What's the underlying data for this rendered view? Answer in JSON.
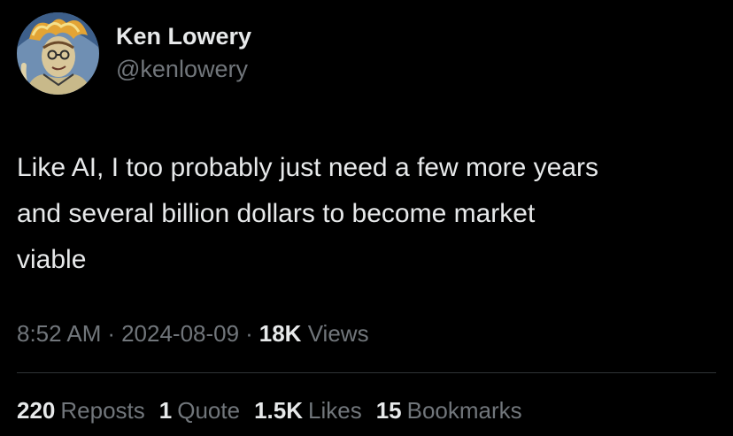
{
  "colors": {
    "background": "#000000",
    "primary_text": "#e7e9ea",
    "secondary_text": "#71767b",
    "divider": "#2f3336"
  },
  "author": {
    "avatar_icon": "illustrated-portrait-avatar",
    "display_name": "Ken Lowery",
    "handle": "@kenlowery"
  },
  "tweet": {
    "text": "Like AI, I too probably just need a few more years\nand several billion dollars to become market\nviable",
    "time": "8:52 AM",
    "separator": "·",
    "date": "2024-08-09",
    "views_count": "18K",
    "views_label": "Views"
  },
  "stats": [
    {
      "count": "220",
      "label": "Reposts"
    },
    {
      "count": "1",
      "label": "Quote"
    },
    {
      "count": "1.5K",
      "label": "Likes"
    },
    {
      "count": "15",
      "label": "Bookmarks"
    }
  ]
}
